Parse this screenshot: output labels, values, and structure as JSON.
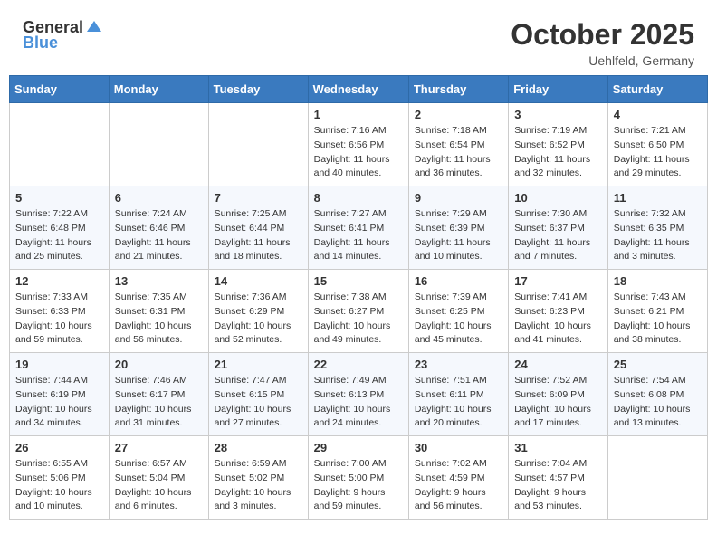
{
  "header": {
    "logo_general": "General",
    "logo_blue": "Blue",
    "month": "October 2025",
    "location": "Uehlfeld, Germany"
  },
  "weekdays": [
    "Sunday",
    "Monday",
    "Tuesday",
    "Wednesday",
    "Thursday",
    "Friday",
    "Saturday"
  ],
  "weeks": [
    [
      {
        "day": "",
        "info": ""
      },
      {
        "day": "",
        "info": ""
      },
      {
        "day": "",
        "info": ""
      },
      {
        "day": "1",
        "info": "Sunrise: 7:16 AM\nSunset: 6:56 PM\nDaylight: 11 hours\nand 40 minutes."
      },
      {
        "day": "2",
        "info": "Sunrise: 7:18 AM\nSunset: 6:54 PM\nDaylight: 11 hours\nand 36 minutes."
      },
      {
        "day": "3",
        "info": "Sunrise: 7:19 AM\nSunset: 6:52 PM\nDaylight: 11 hours\nand 32 minutes."
      },
      {
        "day": "4",
        "info": "Sunrise: 7:21 AM\nSunset: 6:50 PM\nDaylight: 11 hours\nand 29 minutes."
      }
    ],
    [
      {
        "day": "5",
        "info": "Sunrise: 7:22 AM\nSunset: 6:48 PM\nDaylight: 11 hours\nand 25 minutes."
      },
      {
        "day": "6",
        "info": "Sunrise: 7:24 AM\nSunset: 6:46 PM\nDaylight: 11 hours\nand 21 minutes."
      },
      {
        "day": "7",
        "info": "Sunrise: 7:25 AM\nSunset: 6:44 PM\nDaylight: 11 hours\nand 18 minutes."
      },
      {
        "day": "8",
        "info": "Sunrise: 7:27 AM\nSunset: 6:41 PM\nDaylight: 11 hours\nand 14 minutes."
      },
      {
        "day": "9",
        "info": "Sunrise: 7:29 AM\nSunset: 6:39 PM\nDaylight: 11 hours\nand 10 minutes."
      },
      {
        "day": "10",
        "info": "Sunrise: 7:30 AM\nSunset: 6:37 PM\nDaylight: 11 hours\nand 7 minutes."
      },
      {
        "day": "11",
        "info": "Sunrise: 7:32 AM\nSunset: 6:35 PM\nDaylight: 11 hours\nand 3 minutes."
      }
    ],
    [
      {
        "day": "12",
        "info": "Sunrise: 7:33 AM\nSunset: 6:33 PM\nDaylight: 10 hours\nand 59 minutes."
      },
      {
        "day": "13",
        "info": "Sunrise: 7:35 AM\nSunset: 6:31 PM\nDaylight: 10 hours\nand 56 minutes."
      },
      {
        "day": "14",
        "info": "Sunrise: 7:36 AM\nSunset: 6:29 PM\nDaylight: 10 hours\nand 52 minutes."
      },
      {
        "day": "15",
        "info": "Sunrise: 7:38 AM\nSunset: 6:27 PM\nDaylight: 10 hours\nand 49 minutes."
      },
      {
        "day": "16",
        "info": "Sunrise: 7:39 AM\nSunset: 6:25 PM\nDaylight: 10 hours\nand 45 minutes."
      },
      {
        "day": "17",
        "info": "Sunrise: 7:41 AM\nSunset: 6:23 PM\nDaylight: 10 hours\nand 41 minutes."
      },
      {
        "day": "18",
        "info": "Sunrise: 7:43 AM\nSunset: 6:21 PM\nDaylight: 10 hours\nand 38 minutes."
      }
    ],
    [
      {
        "day": "19",
        "info": "Sunrise: 7:44 AM\nSunset: 6:19 PM\nDaylight: 10 hours\nand 34 minutes."
      },
      {
        "day": "20",
        "info": "Sunrise: 7:46 AM\nSunset: 6:17 PM\nDaylight: 10 hours\nand 31 minutes."
      },
      {
        "day": "21",
        "info": "Sunrise: 7:47 AM\nSunset: 6:15 PM\nDaylight: 10 hours\nand 27 minutes."
      },
      {
        "day": "22",
        "info": "Sunrise: 7:49 AM\nSunset: 6:13 PM\nDaylight: 10 hours\nand 24 minutes."
      },
      {
        "day": "23",
        "info": "Sunrise: 7:51 AM\nSunset: 6:11 PM\nDaylight: 10 hours\nand 20 minutes."
      },
      {
        "day": "24",
        "info": "Sunrise: 7:52 AM\nSunset: 6:09 PM\nDaylight: 10 hours\nand 17 minutes."
      },
      {
        "day": "25",
        "info": "Sunrise: 7:54 AM\nSunset: 6:08 PM\nDaylight: 10 hours\nand 13 minutes."
      }
    ],
    [
      {
        "day": "26",
        "info": "Sunrise: 6:55 AM\nSunset: 5:06 PM\nDaylight: 10 hours\nand 10 minutes."
      },
      {
        "day": "27",
        "info": "Sunrise: 6:57 AM\nSunset: 5:04 PM\nDaylight: 10 hours\nand 6 minutes."
      },
      {
        "day": "28",
        "info": "Sunrise: 6:59 AM\nSunset: 5:02 PM\nDaylight: 10 hours\nand 3 minutes."
      },
      {
        "day": "29",
        "info": "Sunrise: 7:00 AM\nSunset: 5:00 PM\nDaylight: 9 hours\nand 59 minutes."
      },
      {
        "day": "30",
        "info": "Sunrise: 7:02 AM\nSunset: 4:59 PM\nDaylight: 9 hours\nand 56 minutes."
      },
      {
        "day": "31",
        "info": "Sunrise: 7:04 AM\nSunset: 4:57 PM\nDaylight: 9 hours\nand 53 minutes."
      },
      {
        "day": "",
        "info": ""
      }
    ]
  ]
}
